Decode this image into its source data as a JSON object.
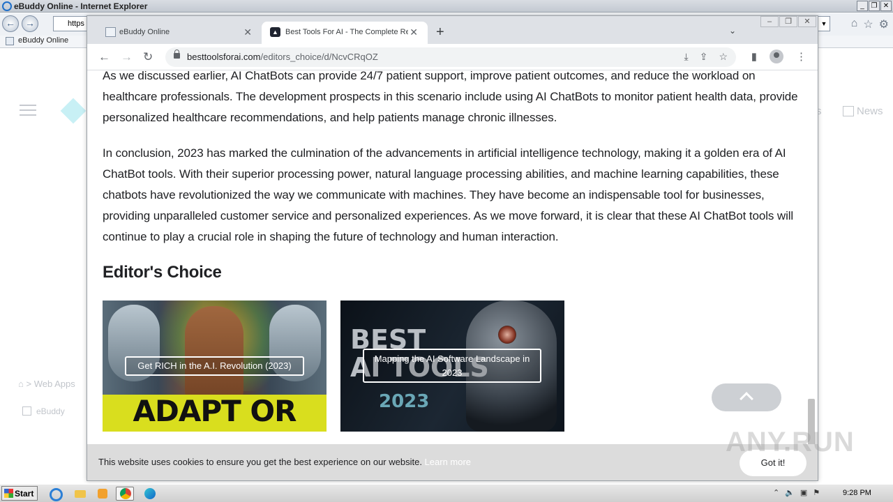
{
  "ie": {
    "title": "eBuddy Online - Internet Explorer",
    "address_partial": "https",
    "tab_label": "eBuddy Online",
    "news_label": "News",
    "news_partial": "s",
    "breadcrumb": "Web Apps",
    "breadcrumb_sep": ">",
    "sidebar_item": "eBuddy"
  },
  "chrome": {
    "tabs": [
      {
        "label": "eBuddy Online",
        "active": false
      },
      {
        "label": "Best Tools For AI - The Complete Res",
        "active": true
      }
    ],
    "url_host": "besttoolsforai.com",
    "url_path": "/editors_choice/d/NcvCRqOZ"
  },
  "page": {
    "paragraph1": "As we discussed earlier, AI ChatBots can provide 24/7 patient support, improve patient outcomes, and reduce the workload on healthcare professionals. The development prospects in this scenario include using AI ChatBots to monitor patient health data, provide personalized healthcare recommendations, and help patients manage chronic illnesses.",
    "paragraph2": "In conclusion, 2023 has marked the culmination of the advancements in artificial intelligence technology, making it a golden era of AI ChatBot tools. With their superior processing power, natural language processing abilities, and machine learning capabilities, these chatbots have revolutionized the way we communicate with machines. They have become an indispensable tool for businesses, providing unparalleled customer service and personalized experiences. As we move forward, it is clear that these AI ChatBot tools will continue to play a crucial role in shaping the future of technology and human interaction.",
    "section_title": "Editor's Choice",
    "cards": [
      {
        "caption": "Get RICH in the A.I. Revolution (2023)",
        "image_text": "ADAPT OR DIE"
      },
      {
        "caption": "Mapping the AI Software Landscape in 2023",
        "image_text_1": "BEST\nAI TOOLS",
        "image_text_2": "2023"
      }
    ],
    "cookie_text": "This website uses cookies to ensure you get the best experience on our website.",
    "cookie_link": "Learn more",
    "cookie_button": "Got it!"
  },
  "watermark": "ANY.RUN",
  "taskbar": {
    "start_label": "Start",
    "clock": "9:28 PM"
  }
}
